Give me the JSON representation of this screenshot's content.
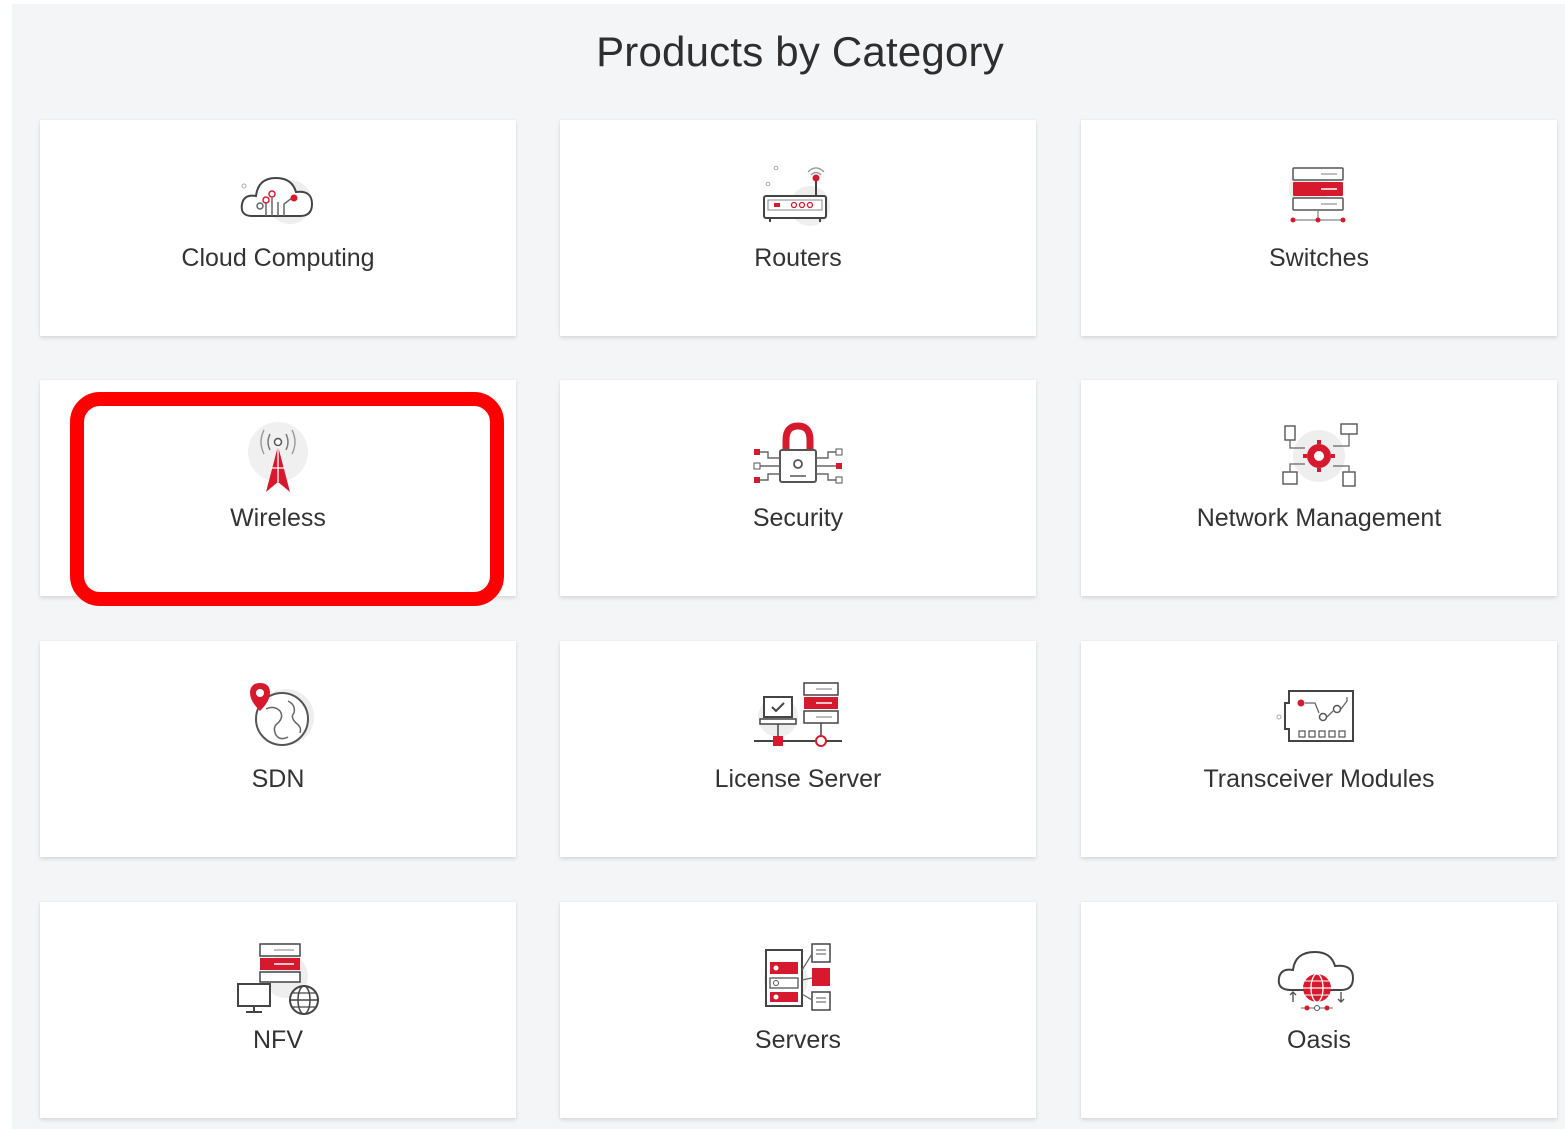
{
  "page_title": "Products by Category",
  "accent_color": "#d7192e",
  "highlight_color": "#ff0000",
  "categories": [
    {
      "label": "Cloud Computing",
      "icon": "cloud-computing-icon"
    },
    {
      "label": "Routers",
      "icon": "router-icon"
    },
    {
      "label": "Switches",
      "icon": "switch-icon"
    },
    {
      "label": "Wireless",
      "icon": "wireless-tower-icon",
      "highlighted": true
    },
    {
      "label": "Security",
      "icon": "security-lock-icon"
    },
    {
      "label": "Network Management",
      "icon": "network-management-icon"
    },
    {
      "label": "SDN",
      "icon": "sdn-globe-icon"
    },
    {
      "label": "License Server",
      "icon": "license-server-icon"
    },
    {
      "label": "Transceiver Modules",
      "icon": "transceiver-module-icon"
    },
    {
      "label": "NFV",
      "icon": "nfv-icon"
    },
    {
      "label": "Servers",
      "icon": "servers-icon"
    },
    {
      "label": "Oasis",
      "icon": "oasis-cloud-icon"
    }
  ]
}
